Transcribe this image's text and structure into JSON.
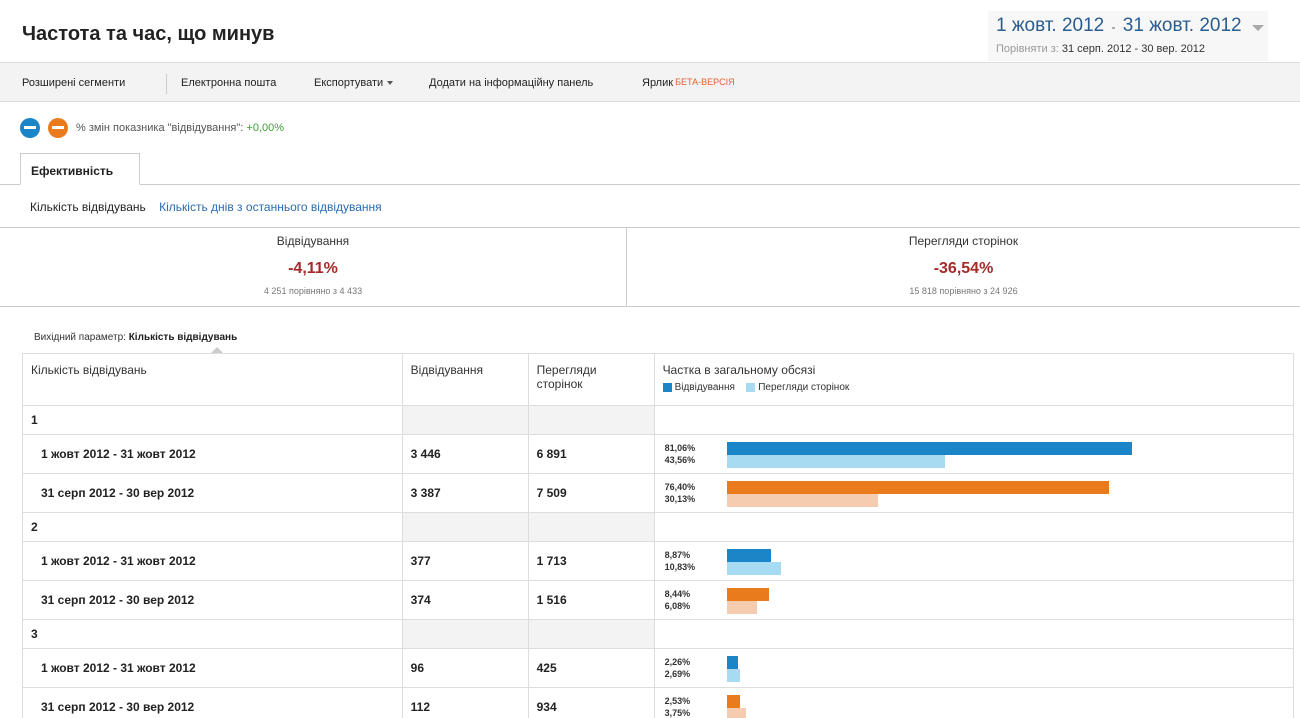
{
  "title": "Частота та час, що минув",
  "date_range": {
    "start": "1 жовт. 2012",
    "separator": "-",
    "end": "31 жовт. 2012",
    "compare_label": "Порівняти з:",
    "compare_range": "31 серп. 2012 - 30 вер. 2012"
  },
  "toolbar": {
    "advanced_segments": "Розширені сегменти",
    "email": "Електронна пошта",
    "export": "Експортувати",
    "add_to_dashboard": "Додати на інформаційну панель",
    "shortcut": "Ярлик",
    "beta": "БЕТА-ВЕРСІЯ"
  },
  "segments": {
    "colors": [
      "#1a85c7",
      "#ea7b1c"
    ],
    "change_label": "% змін показника \"відвідування\":",
    "change_value": "+0,00%"
  },
  "tab": "Ефективність",
  "subnav": {
    "active": "Кількість відвідувань",
    "link": "Кількість днів з останнього відвідування"
  },
  "scorecards": [
    {
      "name": "Відвідування",
      "pct": "-4,11%",
      "compare": "4 251 порівняно з 4 433"
    },
    {
      "name": "Перегляди сторінок",
      "pct": "-36,54%",
      "compare": "15 818 порівняно з 24 926"
    }
  ],
  "primary_dimension": {
    "label": "Вихідний параметр:",
    "value": "Кількість відвідувань"
  },
  "table": {
    "headers": {
      "dimension": "Кількість відвідувань",
      "visits": "Відвідування",
      "pageviews": "Перегляди сторінок",
      "share": "Частка в загальному обсязі"
    },
    "legend": {
      "visits": "Відвідування",
      "pageviews": "Перегляди сторінок"
    },
    "colors": {
      "current_visits": "#1a85c7",
      "current_pageviews": "#a6dbf2",
      "previous_visits": "#ea7b1c",
      "previous_pageviews": "#f6ccb0"
    },
    "groups": [
      {
        "label": "1",
        "rows": [
          {
            "period": "1 жовт 2012 - 31 жовт 2012",
            "visits": "3 446",
            "pageviews": "6 891",
            "visits_pct": "81,06%",
            "pageviews_pct": "43,56%",
            "visits_share": 81.06,
            "pageviews_share": 43.56,
            "kind": "current"
          },
          {
            "period": "31 серп 2012 - 30 вер 2012",
            "visits": "3 387",
            "pageviews": "7 509",
            "visits_pct": "76,40%",
            "pageviews_pct": "30,13%",
            "visits_share": 76.4,
            "pageviews_share": 30.13,
            "kind": "previous"
          }
        ]
      },
      {
        "label": "2",
        "rows": [
          {
            "period": "1 жовт 2012 - 31 жовт 2012",
            "visits": "377",
            "pageviews": "1 713",
            "visits_pct": "8,87%",
            "pageviews_pct": "10,83%",
            "visits_share": 8.87,
            "pageviews_share": 10.83,
            "kind": "current"
          },
          {
            "period": "31 серп 2012 - 30 вер 2012",
            "visits": "374",
            "pageviews": "1 516",
            "visits_pct": "8,44%",
            "pageviews_pct": "6,08%",
            "visits_share": 8.44,
            "pageviews_share": 6.08,
            "kind": "previous"
          }
        ]
      },
      {
        "label": "3",
        "rows": [
          {
            "period": "1 жовт 2012 - 31 жовт 2012",
            "visits": "96",
            "pageviews": "425",
            "visits_pct": "2,26%",
            "pageviews_pct": "2,69%",
            "visits_share": 2.26,
            "pageviews_share": 2.69,
            "kind": "current"
          },
          {
            "period": "31 серп 2012 - 30 вер 2012",
            "visits": "112",
            "pageviews": "934",
            "visits_pct": "2,53%",
            "pageviews_pct": "3,75%",
            "visits_share": 2.53,
            "pageviews_share": 3.75,
            "kind": "previous"
          }
        ]
      }
    ]
  }
}
